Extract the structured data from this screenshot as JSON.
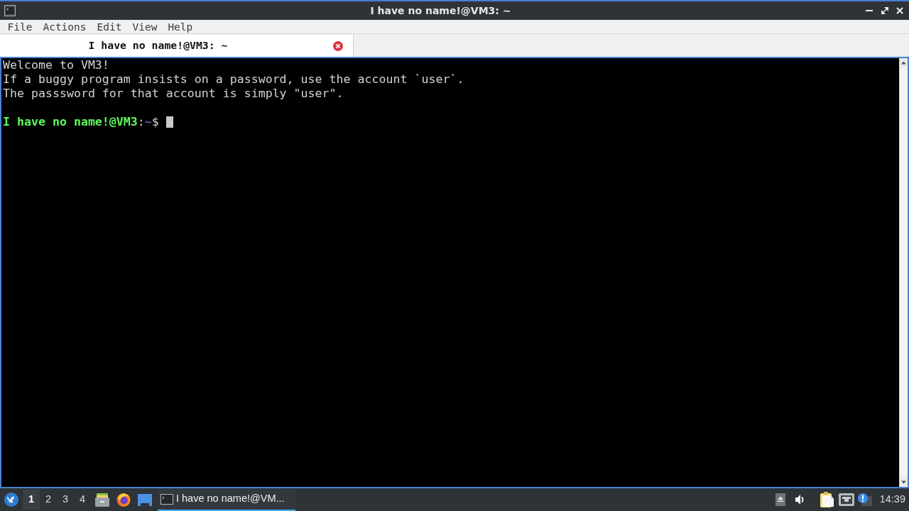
{
  "window": {
    "title": "I have no name!@VM3: ~"
  },
  "menu": [
    "File",
    "Actions",
    "Edit",
    "View",
    "Help"
  ],
  "tabs": [
    {
      "label": "I have no name!@VM3: ~",
      "selected": true
    }
  ],
  "terminal": {
    "lines": [
      {
        "kind": "output",
        "text": "Welcome to VM3!"
      },
      {
        "kind": "output",
        "text": "If a buggy program insists on a password, use the account `user`."
      },
      {
        "kind": "output",
        "text": "The passsword for that account is simply \"user\"."
      },
      {
        "kind": "blank"
      },
      {
        "kind": "prompt",
        "parts": [
          {
            "kind": "user",
            "text": "I have no name!@VM3"
          },
          {
            "kind": "plain",
            "text": ":"
          },
          {
            "kind": "path",
            "text": "~"
          },
          {
            "kind": "plain",
            "text": "$"
          }
        ]
      }
    ]
  },
  "taskbar": {
    "workspaces": [
      {
        "label": "1",
        "selected": true
      },
      {
        "label": "2",
        "selected": false
      },
      {
        "label": "3",
        "selected": false
      },
      {
        "label": "4",
        "selected": false
      }
    ],
    "tasks": [
      {
        "label": "I have no name!@VM...",
        "selected": true
      }
    ],
    "clock": "14:39"
  }
}
